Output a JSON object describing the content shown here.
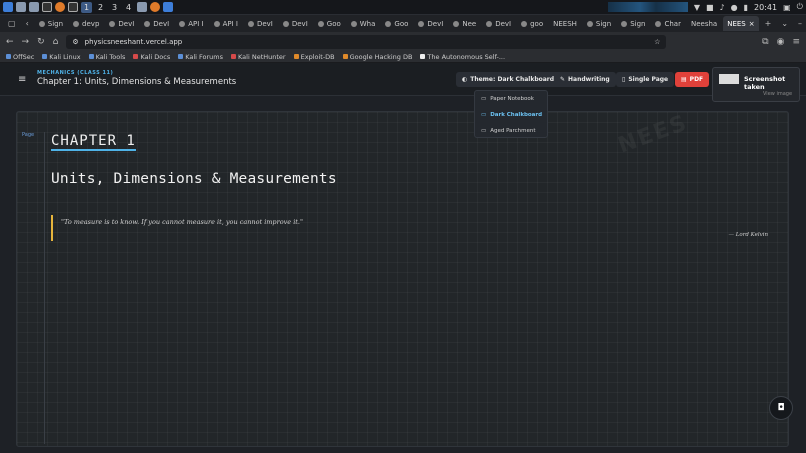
{
  "taskbar": {
    "workspaces": [
      "1",
      "2",
      "3",
      "4"
    ],
    "clock": "20:41"
  },
  "tabs": [
    {
      "label": "Sign"
    },
    {
      "label": "devp"
    },
    {
      "label": "DevI"
    },
    {
      "label": "DevI"
    },
    {
      "label": "API I"
    },
    {
      "label": "API I"
    },
    {
      "label": "DevI"
    },
    {
      "label": "DevI"
    },
    {
      "label": "Goo"
    },
    {
      "label": "Wha"
    },
    {
      "label": "Goo"
    },
    {
      "label": "DevI"
    },
    {
      "label": "Nee"
    },
    {
      "label": "DevI"
    },
    {
      "label": "goo"
    },
    {
      "label": "NEESH"
    },
    {
      "label": "Sign"
    },
    {
      "label": "Sign"
    },
    {
      "label": "Char"
    },
    {
      "label": "Neesha"
    },
    {
      "label": "NEES"
    }
  ],
  "navbar": {
    "url": "physicsneeshant.vercel.app"
  },
  "bookmarks": [
    {
      "label": "OffSec"
    },
    {
      "label": "Kali Linux"
    },
    {
      "label": "Kali Tools"
    },
    {
      "label": "Kali Docs"
    },
    {
      "label": "Kali Forums"
    },
    {
      "label": "Kali NetHunter"
    },
    {
      "label": "Exploit-DB"
    },
    {
      "label": "Google Hacking DB"
    },
    {
      "label": "The Autonomous Self-..."
    }
  ],
  "header": {
    "subject": "MECHANICS (CLASS 11)",
    "title": "Chapter 1: Units, Dimensions & Measurements",
    "theme_button": "Theme: Dark Chalkboard",
    "handwriting_button": "Handwriting",
    "single_page_button": "Single Page",
    "pdf_button": "PDF"
  },
  "theme_menu": {
    "items": [
      {
        "label": "Paper Notebook"
      },
      {
        "label": "Dark Chalkboard"
      },
      {
        "label": "Aged Parchment"
      }
    ]
  },
  "toast": {
    "title": "Screenshot taken",
    "action": "View image"
  },
  "board": {
    "page_label": "Page",
    "watermark": "NEES",
    "chapter_heading": "CHAPTER 1",
    "chapter_title": "Units, Dimensions & Measurements",
    "quote": "\"To measure is to know. If you cannot measure it, you cannot improve it.\"",
    "quote_author": "— Lord Kelvin"
  }
}
